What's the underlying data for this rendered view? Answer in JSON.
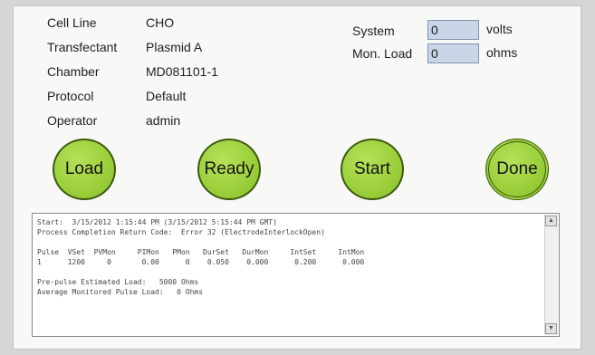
{
  "info": [
    {
      "label": "Cell Line",
      "value": "CHO"
    },
    {
      "label": "Transfectant",
      "value": "Plasmid A"
    },
    {
      "label": "Chamber",
      "value": "MD081101-1"
    },
    {
      "label": "Protocol",
      "value": "Default"
    },
    {
      "label": "Operator",
      "value": "admin"
    }
  ],
  "meters": {
    "system": {
      "label": "System",
      "value": "0",
      "unit": "volts"
    },
    "mon_load": {
      "label": "Mon. Load",
      "value": "0",
      "unit": "ohms"
    }
  },
  "buttons": {
    "load": "Load",
    "ready": "Ready",
    "start": "Start",
    "done": "Done"
  },
  "log": {
    "lines": [
      "Start:  3/15/2012 1:15:44 PM (3/15/2012 5:15:44 PM GMT)",
      "Process Completion Return Code:  Error 32 (ElectrodeInterlockOpen)",
      "",
      "Pulse  VSet  PVMon     PIMon   PMon   DurSet   DurMon     IntSet     IntMon",
      "1      1200     0       0.00      0    0.050    0.000      0.200      0.000",
      "",
      "Pre-pulse Estimated Load:   5000 Ohms",
      "Average Monitored Pulse Load:   0 Ohms"
    ]
  },
  "icons": {
    "scroll_up": "scroll-up-arrow-icon",
    "scroll_down": "scroll-down-arrow-icon"
  },
  "colors": {
    "button_green": "#9dd13c",
    "meter_box": "#c8d6e8"
  }
}
